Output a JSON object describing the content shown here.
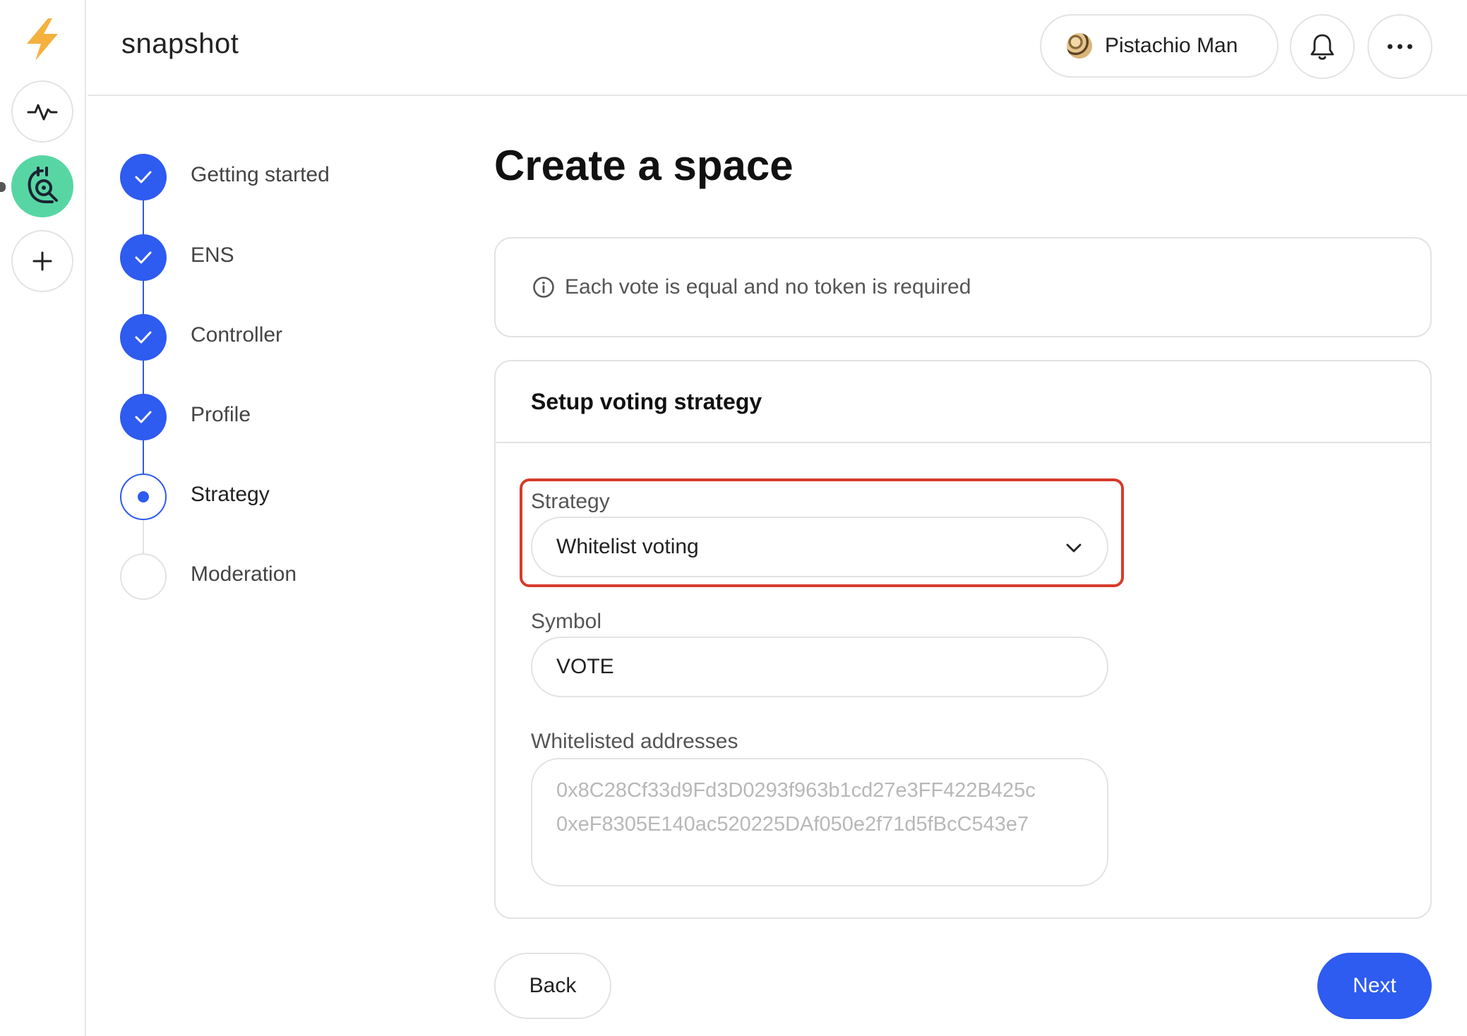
{
  "colors": {
    "accent": "#2e5bf0",
    "highlight": "#d63b2a",
    "space_avatar": "#57d6a3",
    "logo": "#f4b13e"
  },
  "header": {
    "brand": "snapshot",
    "user_name": "Pistachio Man"
  },
  "rail": {
    "items": [
      {
        "icon": "activity-icon"
      },
      {
        "icon": "space-avatar-icon"
      },
      {
        "icon": "plus-icon"
      }
    ]
  },
  "stepper": {
    "steps": [
      {
        "label": "Getting started",
        "state": "done"
      },
      {
        "label": "ENS",
        "state": "done"
      },
      {
        "label": "Controller",
        "state": "done"
      },
      {
        "label": "Profile",
        "state": "done"
      },
      {
        "label": "Strategy",
        "state": "current"
      },
      {
        "label": "Moderation",
        "state": "pending"
      }
    ]
  },
  "main": {
    "title": "Create a space",
    "info_text": "Each vote is equal and no token is required",
    "card_title": "Setup voting strategy",
    "strategy_label": "Strategy",
    "strategy_value": "Whitelist voting",
    "symbol_label": "Symbol",
    "symbol_value": "VOTE",
    "addresses_label": "Whitelisted addresses",
    "addresses_placeholder": [
      "0x8C28Cf33d9Fd3D0293f963b1cd27e3FF422B425c",
      "0xeF8305E140ac520225DAf050e2f71d5fBcC543e7"
    ],
    "back_label": "Back",
    "next_label": "Next"
  }
}
